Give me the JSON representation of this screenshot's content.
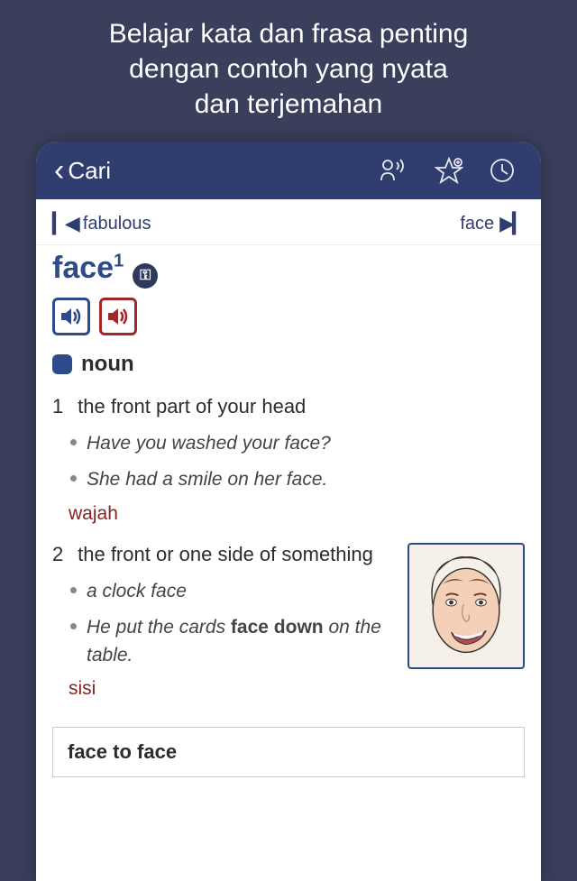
{
  "hero": {
    "line1": "Belajar kata dan frasa penting",
    "line2": "dengan contoh yang nyata",
    "line3": "dan terjemahan"
  },
  "header": {
    "back_label": "Cari"
  },
  "nav": {
    "prev_word": "fabulous",
    "next_word": "face"
  },
  "entry": {
    "headword": "face",
    "homograph": "1",
    "pos": "noun",
    "senses": [
      {
        "num": "1",
        "definition": "the front part of your head",
        "examples": [
          "Have you washed your face?",
          "She had a smile on her face."
        ],
        "translation": "wajah"
      },
      {
        "num": "2",
        "definition": "the front or one side of something",
        "examples": [
          "a clock face",
          "He put the cards <b>face down</b> on the table."
        ],
        "translation": "sisi"
      }
    ],
    "idiom": "face to face"
  }
}
